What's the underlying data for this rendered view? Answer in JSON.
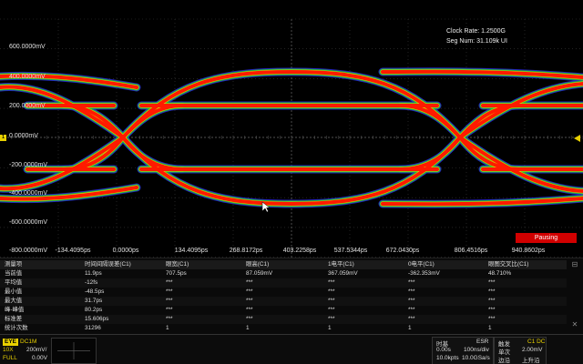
{
  "axes": {
    "y_labels": [
      "600.0000mV",
      "400.0000mV",
      "200.0000mV",
      "0.0000mV",
      "-200.0000mV",
      "-400.0000mV",
      "-600.0000mV",
      "-800.0000mV"
    ],
    "x_labels": [
      "-134.4095ps",
      "0.0000ps",
      "134.4095ps",
      "268.8172ps",
      "403.2258ps",
      "537.5344ps",
      "672.0430ps",
      "806.4516ps",
      "940.8602ps"
    ]
  },
  "clock_info": {
    "clock_rate": "Clock Rate: 1.2500G",
    "seg_num": "Seg Num: 31.109k UI"
  },
  "channel_marker": "1",
  "pausing_label": "Pausing",
  "measurements": {
    "headers": [
      "测量项",
      "时间间隔误差(C1)",
      "眼宽(C1)",
      "眼高(C1)",
      "1电平(C1)",
      "0电平(C1)",
      "眼图交叉比(C1)"
    ],
    "rows": [
      {
        "label": "当前值",
        "values": [
          "11.9ps",
          "707.5ps",
          "87.059mV",
          "367.059mV",
          "-362.353mV",
          "48.710%"
        ]
      },
      {
        "label": "平均值",
        "values": [
          "-12fs",
          "***",
          "***",
          "***",
          "***",
          "***"
        ]
      },
      {
        "label": "最小值",
        "values": [
          "-48.5ps",
          "***",
          "***",
          "***",
          "***",
          "***"
        ]
      },
      {
        "label": "最大值",
        "values": [
          "31.7ps",
          "***",
          "***",
          "***",
          "***",
          "***"
        ]
      },
      {
        "label": "峰-峰值",
        "values": [
          "80.2ps",
          "***",
          "***",
          "***",
          "***",
          "***"
        ]
      },
      {
        "label": "标准差",
        "values": [
          "15.606ps",
          "***",
          "***",
          "***",
          "***",
          "***"
        ]
      },
      {
        "label": "统计次数",
        "values": [
          "31296",
          "1",
          "1",
          "1",
          "1",
          "1"
        ]
      }
    ]
  },
  "status": {
    "mode_badge": "EYE",
    "coupling": "DC1M",
    "probe": "10X",
    "volts_div": "200mV/",
    "bandwidth": "FULL",
    "offset": "0.00V",
    "timebase": {
      "title": "时基",
      "mode": "ESR",
      "delay": "0.00s",
      "time_div": "100ns/div",
      "memory": "10.0kpts",
      "sample_rate": "10.0GSa/s"
    },
    "trigger": {
      "title": "触发",
      "source": "C1 DC",
      "sweep": "单次",
      "level": "2.00mV",
      "type": "边沿",
      "slope": "上升沿"
    }
  },
  "colors": {
    "trace_hot": "#ff1a00",
    "trace_warm": "#e8e800",
    "trace_mid": "#22c030",
    "trace_cold": "#2828d0",
    "accent": "#e8d000",
    "pausing": "#d10000"
  }
}
